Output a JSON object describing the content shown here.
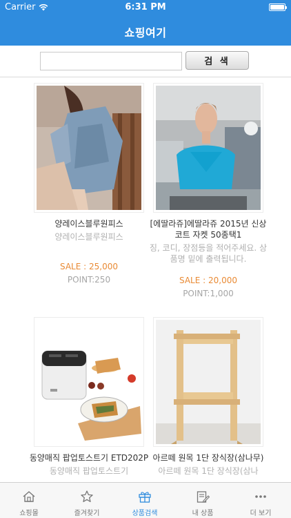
{
  "status_bar": {
    "carrier": "Carrier",
    "time": "6:31 PM"
  },
  "header": {
    "title": "쇼핑여기"
  },
  "search": {
    "placeholder": "",
    "button_label": "검 색"
  },
  "products": [
    {
      "name": "양레이스블루원피스",
      "desc": "양레이스블루원피스",
      "sale": "SALE : 25,000",
      "point": "POINT:250"
    },
    {
      "name": "[에딸라쥬]에딸라쥬 2015년 신상 코트 자켓 50종택1",
      "desc": "징, 코디, 장점등을 적어주세요. 상품명 밑에 출력됩니다.",
      "sale": "SALE : 20,000",
      "point": "POINT:1,000"
    },
    {
      "name": "동양매직 팝업토스트기 ETD202P",
      "desc": "동양매직 팝업토스트기"
    },
    {
      "name": "아르떼 원목 1단 장식장(삼나무)",
      "desc": "아르떼 원목 1단 장식장(삼나"
    }
  ],
  "tabs": [
    {
      "label": "쇼핑몰",
      "icon": "home-icon"
    },
    {
      "label": "즐겨찾기",
      "icon": "star-icon"
    },
    {
      "label": "상품검색",
      "icon": "gift-icon"
    },
    {
      "label": "내 상품",
      "icon": "edit-icon"
    },
    {
      "label": "더 보기",
      "icon": "more-icon"
    }
  ],
  "colors": {
    "accent": "#2f8cde",
    "sale": "#e98a34"
  }
}
